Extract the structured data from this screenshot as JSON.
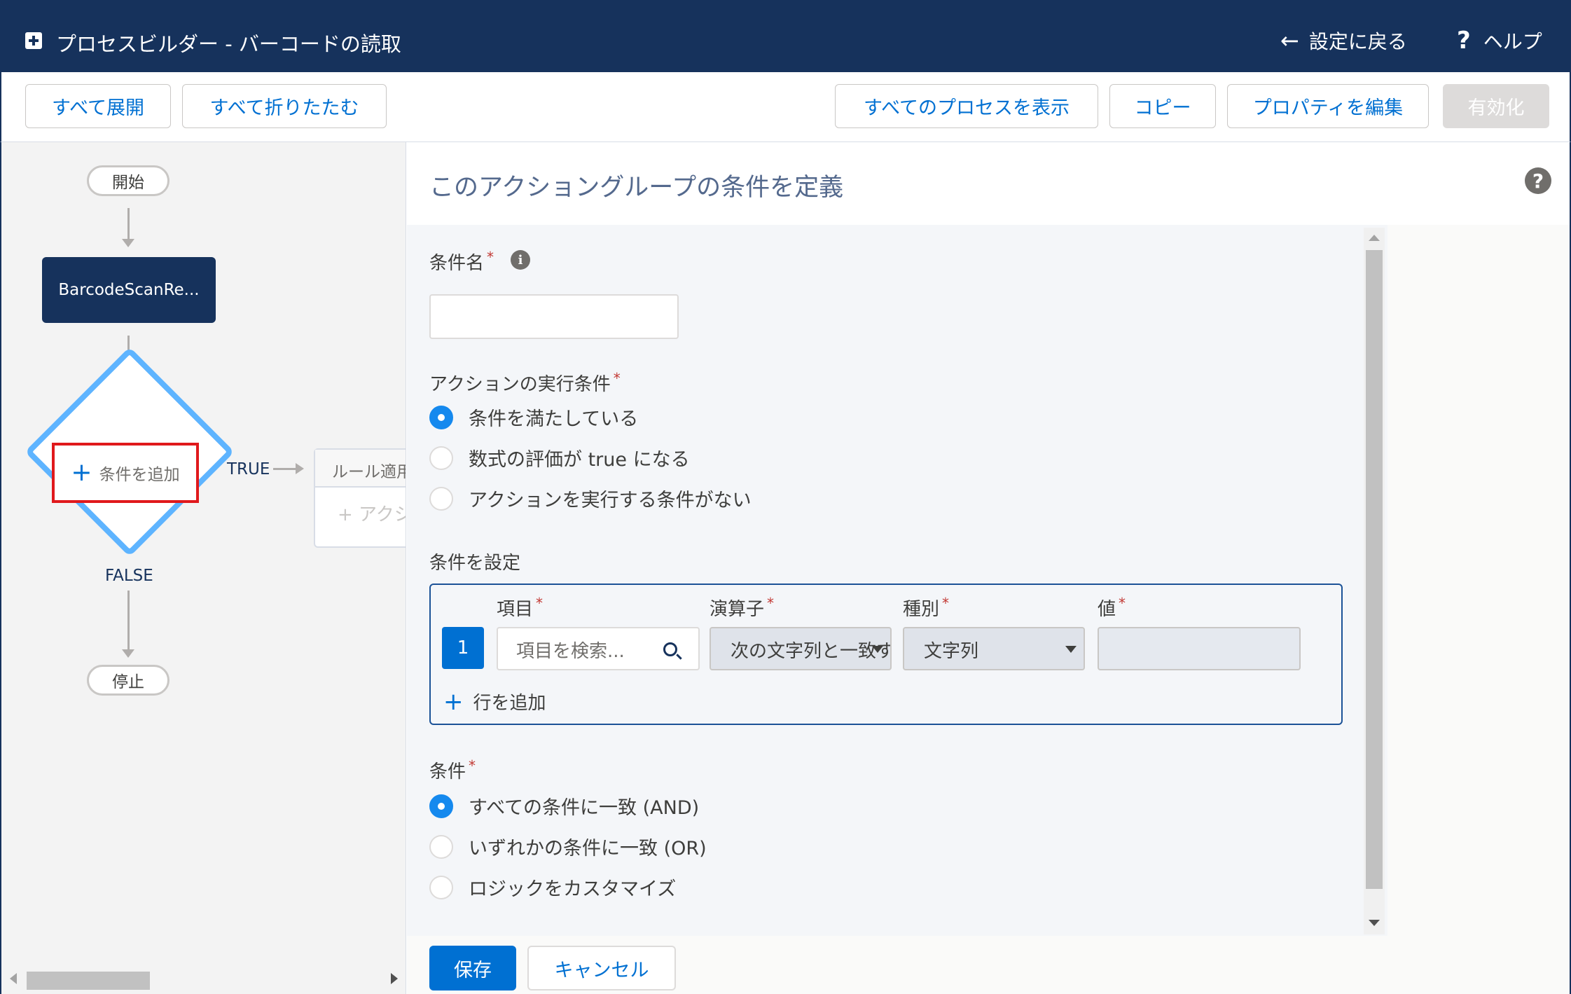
{
  "header": {
    "title": "プロセスビルダー - バーコードの読取",
    "back_label": "設定に戻る",
    "help_label": "ヘルプ"
  },
  "toolbar": {
    "expand_all": "すべて展開",
    "collapse_all": "すべて折りたたむ",
    "view_all_processes": "すべてのプロセスを表示",
    "copy": "コピー",
    "edit_properties": "プロパティを編集",
    "activate": "有効化"
  },
  "canvas": {
    "start": "開始",
    "criteria_node": "BarcodeScanRe...",
    "add_criteria": "条件を追加",
    "true_label": "TRUE",
    "false_label": "FALSE",
    "rule_card_title": "ルール適用",
    "rule_card_action": "+ アクション",
    "stop": "停止"
  },
  "panel": {
    "title": "このアクショングループの条件を定義",
    "condition_name_label": "条件名",
    "condition_name_value": "",
    "execute_label": "アクションの実行条件",
    "execute_options": [
      {
        "label": "条件を満たしている",
        "selected": true
      },
      {
        "label": "数式の評価が true になる",
        "selected": false
      },
      {
        "label": "アクションを実行する条件がない",
        "selected": false
      }
    ],
    "set_conditions_label": "条件を設定",
    "row": {
      "number": "1",
      "field_label": "項目",
      "operator_label": "演算子",
      "type_label": "種別",
      "value_label": "値",
      "field_placeholder": "項目を検索...",
      "operator_value": "次の文字列と一致する",
      "type_value": "文字列",
      "value_value": ""
    },
    "add_row": "行を追加",
    "conditions_label": "条件",
    "condition_options": [
      {
        "label": "すべての条件に一致 (AND)",
        "selected": true
      },
      {
        "label": "いずれかの条件に一致 (OR)",
        "selected": false
      },
      {
        "label": "ロジックをカスタマイズ",
        "selected": false
      }
    ],
    "save": "保存",
    "cancel": "キャンセル"
  },
  "colors": {
    "header_bg": "#16325c",
    "brand_blue": "#0070d2",
    "highlight_red": "#e0191c",
    "diamond_border": "#5eb4ff"
  }
}
